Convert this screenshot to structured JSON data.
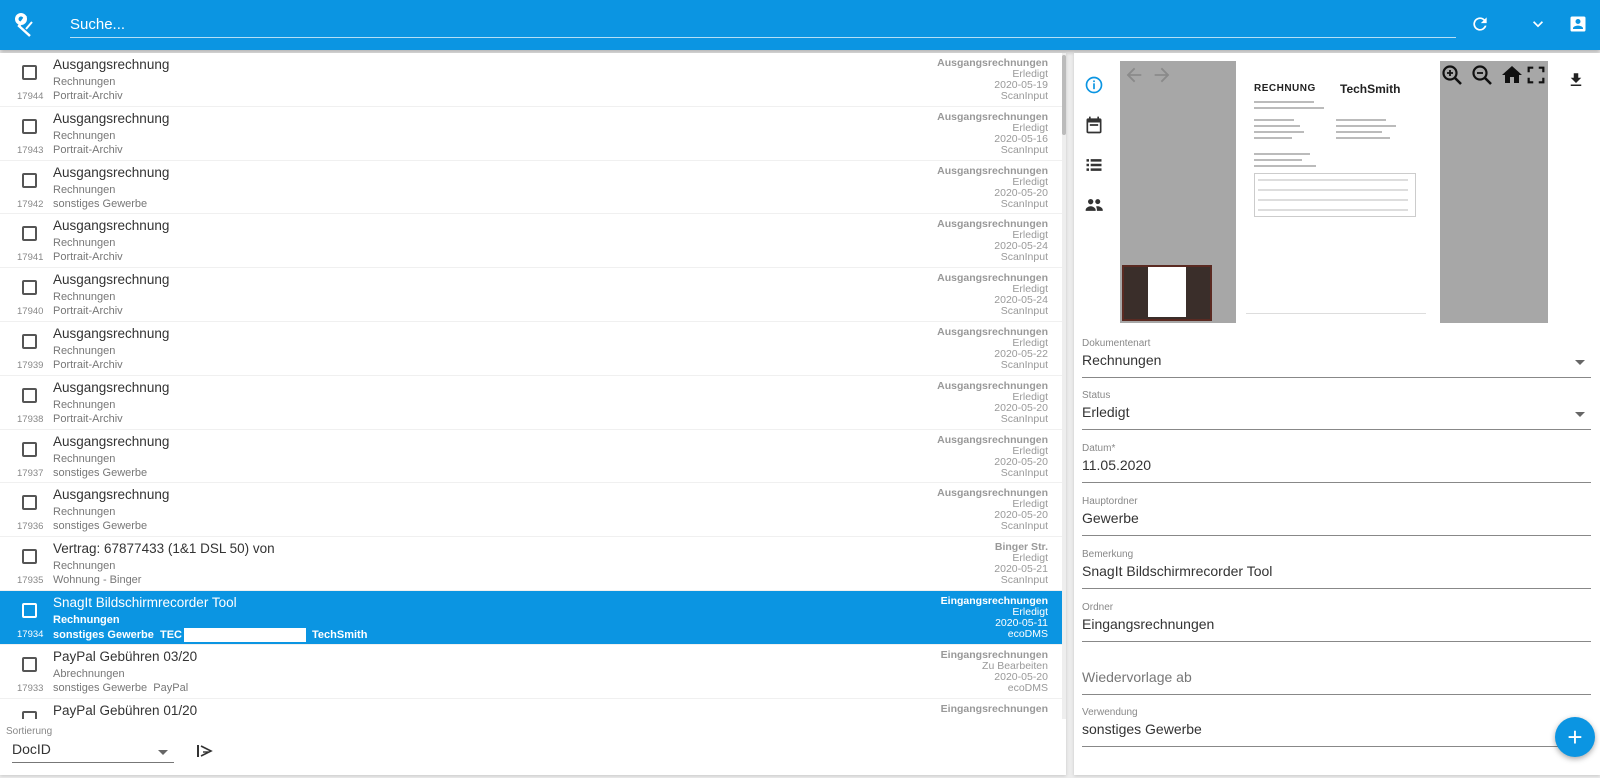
{
  "app": {
    "search_placeholder": "Suche...",
    "accent_color": "#0b95e2"
  },
  "topbar_icons": [
    "logo-icon",
    "refresh-icon",
    "chevron-down-icon",
    "account-icon"
  ],
  "list": {
    "rows": [
      {
        "id": "17944",
        "title": "Ausgangsrechnung",
        "doctype": "Rechnungen",
        "category": "Portrait-Archiv",
        "extra": "",
        "folder": "Ausgangsrechnungen",
        "status": "Erledigt",
        "date": "2020-05-19",
        "source": "ScanInput",
        "selected": false
      },
      {
        "id": "17943",
        "title": "Ausgangsrechnung",
        "doctype": "Rechnungen",
        "category": "Portrait-Archiv",
        "extra": "",
        "folder": "Ausgangsrechnungen",
        "status": "Erledigt",
        "date": "2020-05-16",
        "source": "ScanInput",
        "selected": false
      },
      {
        "id": "17942",
        "title": "Ausgangsrechnung",
        "doctype": "Rechnungen",
        "category": "sonstiges Gewerbe",
        "extra": "",
        "folder": "Ausgangsrechnungen",
        "status": "Erledigt",
        "date": "2020-05-20",
        "source": "ScanInput",
        "selected": false
      },
      {
        "id": "17941",
        "title": "Ausgangsrechnung",
        "doctype": "Rechnungen",
        "category": "Portrait-Archiv",
        "extra": "",
        "folder": "Ausgangsrechnungen",
        "status": "Erledigt",
        "date": "2020-05-24",
        "source": "ScanInput",
        "selected": false
      },
      {
        "id": "17940",
        "title": "Ausgangsrechnung",
        "doctype": "Rechnungen",
        "category": "Portrait-Archiv",
        "extra": "",
        "folder": "Ausgangsrechnungen",
        "status": "Erledigt",
        "date": "2020-05-24",
        "source": "ScanInput",
        "selected": false
      },
      {
        "id": "17939",
        "title": "Ausgangsrechnung",
        "doctype": "Rechnungen",
        "category": "Portrait-Archiv",
        "extra": "",
        "folder": "Ausgangsrechnungen",
        "status": "Erledigt",
        "date": "2020-05-22",
        "source": "ScanInput",
        "selected": false
      },
      {
        "id": "17938",
        "title": "Ausgangsrechnung",
        "doctype": "Rechnungen",
        "category": "Portrait-Archiv",
        "extra": "",
        "folder": "Ausgangsrechnungen",
        "status": "Erledigt",
        "date": "2020-05-20",
        "source": "ScanInput",
        "selected": false
      },
      {
        "id": "17937",
        "title": "Ausgangsrechnung",
        "doctype": "Rechnungen",
        "category": "sonstiges Gewerbe",
        "extra": "",
        "folder": "Ausgangsrechnungen",
        "status": "Erledigt",
        "date": "2020-05-20",
        "source": "ScanInput",
        "selected": false
      },
      {
        "id": "17936",
        "title": "Ausgangsrechnung",
        "doctype": "Rechnungen",
        "category": "sonstiges Gewerbe",
        "extra": "",
        "folder": "Ausgangsrechnungen",
        "status": "Erledigt",
        "date": "2020-05-20",
        "source": "ScanInput",
        "selected": false
      },
      {
        "id": "17935",
        "title": "Vertrag: 67877433 (1&1 DSL 50) von",
        "doctype": "Rechnungen",
        "category": "Wohnung - Binger",
        "extra": "",
        "folder": "Binger Str.",
        "status": "Erledigt",
        "date": "2020-05-21",
        "source": "ScanInput",
        "selected": false
      },
      {
        "id": "17934",
        "title": "SnagIt Bildschirmrecorder Tool",
        "doctype": "Rechnungen",
        "category": "sonstiges Gewerbe",
        "extra_prefix": "TEC",
        "extra": "TechSmith",
        "folder": "Eingangsrechnungen",
        "status": "Erledigt",
        "date": "2020-05-11",
        "source": "ecoDMS",
        "selected": true
      },
      {
        "id": "17933",
        "title": "PayPal Gebühren 03/20",
        "doctype": "Abrechnungen",
        "category": "sonstiges Gewerbe",
        "extra": "PayPal",
        "folder": "Eingangsrechnungen",
        "status": "Zu Bearbeiten",
        "date": "2020-05-20",
        "source": "ecoDMS",
        "selected": false
      },
      {
        "id": "",
        "title": "PayPal Gebühren 01/20",
        "doctype": "",
        "category": "",
        "extra": "",
        "folder": "Eingangsrechnungen",
        "status": "",
        "date": "",
        "source": "",
        "selected": false
      }
    ]
  },
  "sort": {
    "label": "Sortierung",
    "value": "DocID"
  },
  "preview": {
    "invoice_heading": "RECHNUNG",
    "brand": "TechSmith"
  },
  "detail": {
    "fields": [
      {
        "label": "Dokumentenart",
        "value": "Rechnungen",
        "dropdown": true
      },
      {
        "label": "Status",
        "value": "Erledigt",
        "dropdown": true
      },
      {
        "label": "Datum*",
        "value": "11.05.2020",
        "dropdown": false
      },
      {
        "label": "Hauptordner",
        "value": "Gewerbe",
        "dropdown": false
      },
      {
        "label": "Bemerkung",
        "value": "SnagIt Bildschirmrecorder Tool",
        "dropdown": false
      },
      {
        "label": "Ordner",
        "value": "Eingangsrechnungen",
        "dropdown": false
      },
      {
        "label": "",
        "value": "Wiedervorlage ab",
        "dropdown": false,
        "placeholder": true
      },
      {
        "label": "Verwendung",
        "value": "sonstiges Gewerbe",
        "dropdown": false
      }
    ],
    "fab_label": "+"
  }
}
